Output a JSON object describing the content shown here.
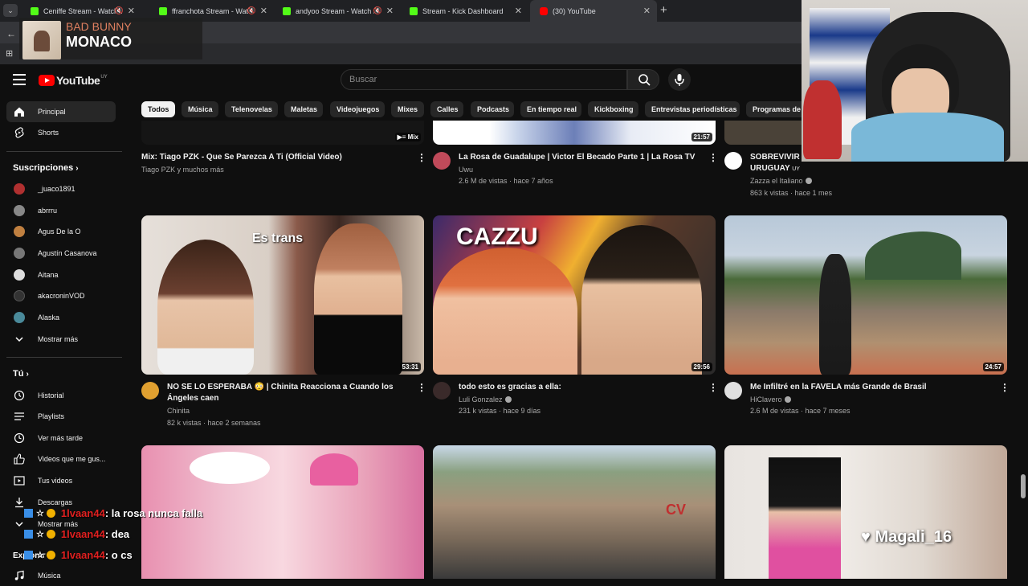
{
  "browser": {
    "tabs": [
      {
        "title": "Ceniffe Stream - Watch Live",
        "color": "#53fc18",
        "active": false
      },
      {
        "title": "ffranchota Stream - Watch",
        "color": "#53fc18",
        "active": false
      },
      {
        "title": "andyoo Stream - Watch Live",
        "color": "#53fc18",
        "active": false
      },
      {
        "title": "Stream - Kick Dashboard",
        "color": "#53fc18",
        "active": false
      },
      {
        "title": "(30) YouTube",
        "color": "#ff0000",
        "active": true
      }
    ]
  },
  "music_overlay": {
    "artist": "BAD BUNNY",
    "song": "MONACO"
  },
  "youtube": {
    "logo_text": "YouTube",
    "country_code": "UY",
    "search_placeholder": "Buscar",
    "chips": [
      "Todos",
      "Música",
      "Telenovelas",
      "Maletas",
      "Videojuegos",
      "Mixes",
      "Calles",
      "Podcasts",
      "En tiempo real",
      "Kickboxing",
      "Entrevistas periodísticas",
      "Programas de"
    ]
  },
  "sidebar": {
    "main": [
      {
        "label": "Principal",
        "icon": "home-icon"
      },
      {
        "label": "Shorts",
        "icon": "shorts-icon"
      }
    ],
    "subs_heading": "Suscripciones",
    "subs": [
      {
        "label": "_juaco1891",
        "color": "#b03030"
      },
      {
        "label": "abrrru",
        "color": "#888888"
      },
      {
        "label": "Agus De la O",
        "color": "#c08040"
      },
      {
        "label": "Agustín Casanova",
        "color": "#777777"
      },
      {
        "label": "Aitana",
        "color": "#dddddd"
      },
      {
        "label": "akacroninVOD",
        "color": "#333333"
      },
      {
        "label": "Alaska",
        "color": "#4a8a9a"
      }
    ],
    "show_more": "Mostrar más",
    "you_heading": "Tú",
    "you": [
      {
        "label": "Historial",
        "icon": "history-icon"
      },
      {
        "label": "Playlists",
        "icon": "playlists-icon"
      },
      {
        "label": "Ver más tarde",
        "icon": "clock-icon"
      },
      {
        "label": "Videos que me gus...",
        "icon": "thumbs-up-icon"
      },
      {
        "label": "Tus videos",
        "icon": "play-square-icon"
      },
      {
        "label": "Descargas",
        "icon": "download-icon"
      }
    ],
    "show_more_2": "Mostrar más",
    "explore_heading": "Explorar",
    "explore": [
      {
        "label": "Música"
      }
    ]
  },
  "top_row": [
    {
      "title": "Mix: Tiago PZK - Que Se Parezca A Ti  (Official Video)",
      "channel": "Tiago PZK y muchos más",
      "stats": "",
      "badge": "Mix"
    },
    {
      "title": "La Rosa de Guadalupe | Victor El Becado Parte 1 | La Rosa TV",
      "channel": "Uwu",
      "stats": "2.6 M de vistas · hace 7 años",
      "duration": "21:57"
    },
    {
      "title": "SOBREVIVIR",
      "title2": "URUGUAY",
      "title2_suffix": "UY",
      "channel": "Zazza el Italiano",
      "stats": "863 k vistas · hace 1 mes"
    }
  ],
  "row2": [
    {
      "title": "NO SE LO ESPERABA 😳 | Chinita Reacciona a Cuando los Ángeles caen",
      "channel": "Chinita",
      "stats": "82 k vistas · hace 2 semanas",
      "duration": "53:31",
      "overlay": "Es trans"
    },
    {
      "title": "todo esto es gracias a ella:",
      "channel": "Luli Gonzalez",
      "stats": "231 k vistas · hace 9 días",
      "duration": "29:56",
      "overlay": "CAZZU"
    },
    {
      "title": "Me Infiltré en la FAVELA más Grande de Brasil",
      "channel": "HiClavero",
      "stats": "2.6 M de vistas · hace 7 meses",
      "duration": "24:57"
    }
  ],
  "row3": [
    {
      "overlay": ""
    },
    {
      "overlay": "CV"
    },
    {
      "overlay": "Magali_16"
    }
  ],
  "chat": [
    {
      "user": "1lvaan44",
      "msg": ": la rosa nunca falla"
    },
    {
      "user": "1lvaan44",
      "msg": ": dea"
    },
    {
      "user": "1lvaan44",
      "msg": ": o cs"
    }
  ]
}
